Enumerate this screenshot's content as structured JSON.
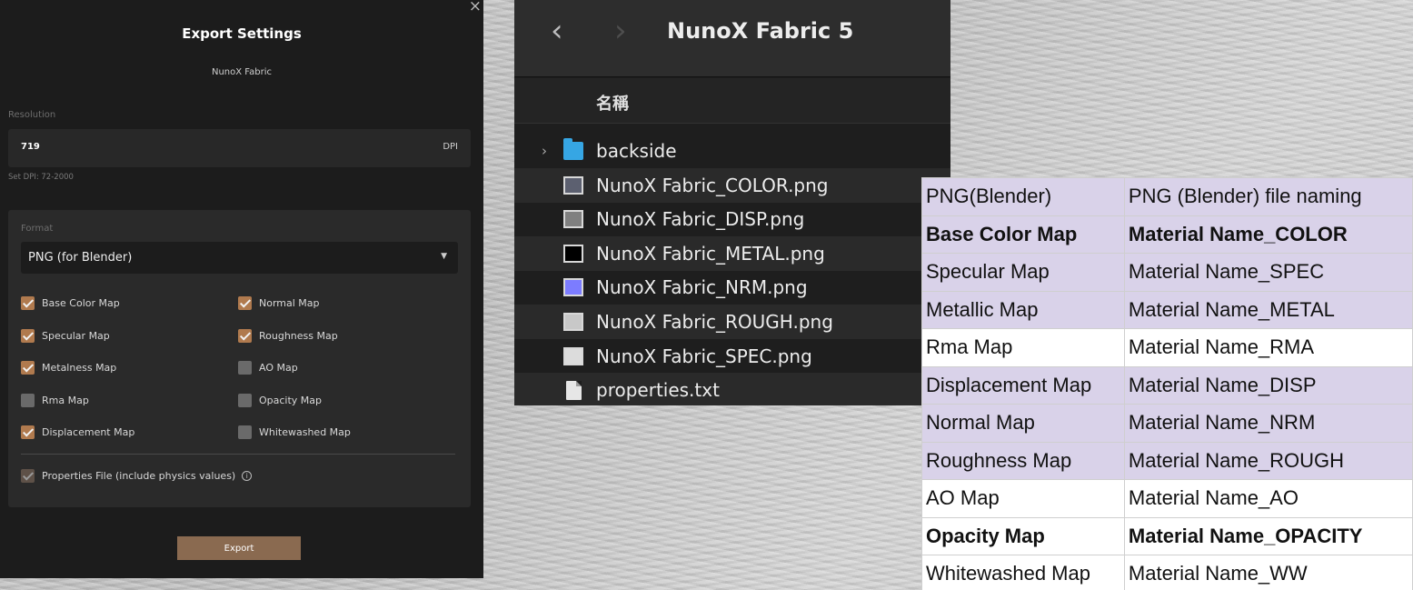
{
  "dialog": {
    "close": "×",
    "title": "Export Settings",
    "subtitle": "NunoX Fabric",
    "resolution": {
      "label": "Resolution",
      "value": "719",
      "unit": "DPI",
      "hint": "Set DPI: 72-2000"
    },
    "format": {
      "label": "Format",
      "selected": "PNG (for Blender)",
      "maps": [
        {
          "label": "Base Color Map",
          "checked": true
        },
        {
          "label": "Normal Map",
          "checked": true
        },
        {
          "label": "Specular Map",
          "checked": true
        },
        {
          "label": "Roughness Map",
          "checked": true
        },
        {
          "label": "Metalness Map",
          "checked": true
        },
        {
          "label": "AO Map",
          "checked": false
        },
        {
          "label": "Rma Map",
          "checked": false
        },
        {
          "label": "Opacity Map",
          "checked": false
        },
        {
          "label": "Displacement Map",
          "checked": true
        },
        {
          "label": "Whitewashed Map",
          "checked": false
        }
      ],
      "properties_file": {
        "label": "Properties File (include physics values)",
        "checked": true,
        "info": "i"
      }
    },
    "export_button": "Export",
    "colors": {
      "accent": "#b07a4e",
      "button": "#8a6a50",
      "background": "#1c1c1c"
    }
  },
  "finder": {
    "back": "‹",
    "forward": "›",
    "title": "NunoX Fabric 5",
    "column_name": "名稱",
    "items": [
      {
        "name": "backside",
        "icon": "folder-icon",
        "expandable": true
      },
      {
        "name": "NunoX Fabric_COLOR.png",
        "icon": "image-thumbnail-icon",
        "thumb": "#5c6070"
      },
      {
        "name": "NunoX Fabric_DISP.png",
        "icon": "image-thumbnail-icon",
        "thumb": "#808080"
      },
      {
        "name": "NunoX Fabric_METAL.png",
        "icon": "image-thumbnail-icon",
        "thumb": "#000000"
      },
      {
        "name": "NunoX Fabric_NRM.png",
        "icon": "image-thumbnail-icon",
        "thumb": "#7c7cff"
      },
      {
        "name": "NunoX Fabric_ROUGH.png",
        "icon": "image-thumbnail-icon",
        "thumb": "#c8c8c8"
      },
      {
        "name": "NunoX Fabric_SPEC.png",
        "icon": "image-thumbnail-icon",
        "thumb": "#dcdcdc"
      },
      {
        "name": "properties.txt",
        "icon": "text-document-icon"
      }
    ]
  },
  "naming_table": {
    "rows": [
      {
        "map": "PNG(Blender)",
        "naming": "PNG (Blender) file naming",
        "style": "purple",
        "bold": false
      },
      {
        "map": "Base Color Map",
        "naming": "Material Name_COLOR",
        "style": "purple",
        "bold": true
      },
      {
        "map": "Specular Map",
        "naming": "Material Name_SPEC",
        "style": "purple",
        "bold": false
      },
      {
        "map": "Metallic Map",
        "naming": "Material Name_METAL",
        "style": "purple",
        "bold": false
      },
      {
        "map": "Rma Map",
        "naming": "Material Name_RMA",
        "style": "white",
        "bold": false
      },
      {
        "map": "Displacement Map",
        "naming": "Material Name_DISP",
        "style": "purple",
        "bold": false
      },
      {
        "map": "Normal Map",
        "naming": "Material Name_NRM",
        "style": "purple",
        "bold": false
      },
      {
        "map": "Roughness Map",
        "naming": "Material Name_ROUGH",
        "style": "purple",
        "bold": false
      },
      {
        "map": "AO Map",
        "naming": "Material Name_AO",
        "style": "white",
        "bold": false
      },
      {
        "map": "Opacity Map",
        "naming": "Material Name_OPACITY",
        "style": "white",
        "bold": true
      },
      {
        "map": "Whitewashed Map",
        "naming": "Material Name_WW",
        "style": "white",
        "bold": false
      }
    ]
  }
}
